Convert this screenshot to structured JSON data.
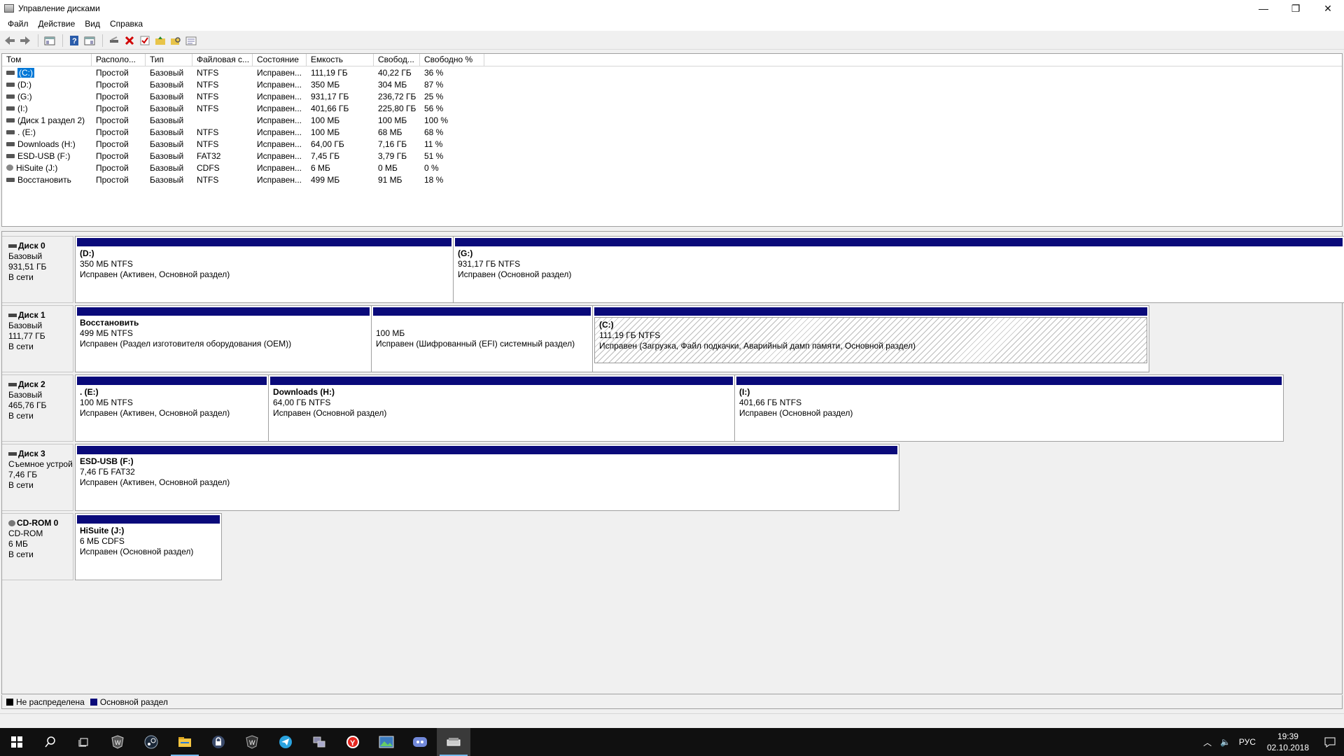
{
  "window": {
    "title": "Управление дисками",
    "minimize": "—",
    "restore": "❐",
    "close": "✕"
  },
  "menu": [
    "Файл",
    "Действие",
    "Вид",
    "Справка"
  ],
  "toolbar_icons": [
    "back-icon",
    "forward-icon",
    "console-tree-icon",
    "help-icon",
    "properties-icon",
    "connect-disk-icon",
    "delete-icon",
    "check-icon",
    "folder-up-icon",
    "search-folder-icon",
    "view-icon"
  ],
  "volume_table": {
    "columns": [
      "Том",
      "Располо...",
      "Тип",
      "Файловая с...",
      "Состояние",
      "Емкость",
      "Свобод...",
      "Свободно %"
    ],
    "rows": [
      {
        "name": "(C:)",
        "layout": "Простой",
        "type": "Базовый",
        "fs": "NTFS",
        "status": "Исправен...",
        "capacity": "111,19 ГБ",
        "free": "40,22 ГБ",
        "pct": "36 %",
        "icon": "drive-icon",
        "selected": true
      },
      {
        "name": "(D:)",
        "layout": "Простой",
        "type": "Базовый",
        "fs": "NTFS",
        "status": "Исправен...",
        "capacity": "350 МБ",
        "free": "304 МБ",
        "pct": "87 %",
        "icon": "drive-icon"
      },
      {
        "name": "(G:)",
        "layout": "Простой",
        "type": "Базовый",
        "fs": "NTFS",
        "status": "Исправен...",
        "capacity": "931,17 ГБ",
        "free": "236,72 ГБ",
        "pct": "25 %",
        "icon": "drive-icon"
      },
      {
        "name": "(I:)",
        "layout": "Простой",
        "type": "Базовый",
        "fs": "NTFS",
        "status": "Исправен...",
        "capacity": "401,66 ГБ",
        "free": "225,80 ГБ",
        "pct": "56 %",
        "icon": "drive-icon"
      },
      {
        "name": "(Диск 1 раздел 2)",
        "layout": "Простой",
        "type": "Базовый",
        "fs": "",
        "status": "Исправен...",
        "capacity": "100 МБ",
        "free": "100 МБ",
        "pct": "100 %",
        "icon": "drive-icon"
      },
      {
        "name": ". (E:)",
        "layout": "Простой",
        "type": "Базовый",
        "fs": "NTFS",
        "status": "Исправен...",
        "capacity": "100 МБ",
        "free": "68 МБ",
        "pct": "68 %",
        "icon": "drive-icon"
      },
      {
        "name": "Downloads (H:)",
        "layout": "Простой",
        "type": "Базовый",
        "fs": "NTFS",
        "status": "Исправен...",
        "capacity": "64,00 ГБ",
        "free": "7,16 ГБ",
        "pct": "11 %",
        "icon": "drive-icon"
      },
      {
        "name": "ESD-USB (F:)",
        "layout": "Простой",
        "type": "Базовый",
        "fs": "FAT32",
        "status": "Исправен...",
        "capacity": "7,45 ГБ",
        "free": "3,79 ГБ",
        "pct": "51 %",
        "icon": "drive-icon"
      },
      {
        "name": "HiSuite (J:)",
        "layout": "Простой",
        "type": "Базовый",
        "fs": "CDFS",
        "status": "Исправен...",
        "capacity": "6 МБ",
        "free": "0 МБ",
        "pct": "0 %",
        "icon": "cd-icon"
      },
      {
        "name": "Восстановить",
        "layout": "Простой",
        "type": "Базовый",
        "fs": "NTFS",
        "status": "Исправен...",
        "capacity": "499 МБ",
        "free": "91 МБ",
        "pct": "18 %",
        "icon": "drive-icon"
      }
    ]
  },
  "disks": [
    {
      "name": "Диск 0",
      "kind": "Базовый",
      "size": "931,51 ГБ",
      "state": "В сети",
      "icon": "disk-icon",
      "partitions": [
        {
          "name": "(D:)",
          "size": "350 МБ NTFS",
          "status": "Исправен (Активен, Основной раздел)"
        },
        {
          "name": "(G:)",
          "size": "931,17 ГБ NTFS",
          "status": "Исправен (Основной раздел)"
        }
      ]
    },
    {
      "name": "Диск 1",
      "kind": "Базовый",
      "size": "111,77 ГБ",
      "state": "В сети",
      "icon": "disk-icon",
      "partitions": [
        {
          "name": "Восстановить",
          "size": "499 МБ NTFS",
          "status": "Исправен (Раздел изготовителя оборудования (OEM))"
        },
        {
          "name": "",
          "size": "100 МБ",
          "status": "Исправен (Шифрованный (EFI) системный раздел)"
        },
        {
          "name": "(C:)",
          "size": "111,19 ГБ NTFS",
          "status": "Исправен (Загрузка, Файл подкачки, Аварийный дамп памяти, Основной раздел)",
          "selected": true
        }
      ]
    },
    {
      "name": "Диск 2",
      "kind": "Базовый",
      "size": "465,76 ГБ",
      "state": "В сети",
      "icon": "disk-icon",
      "partitions": [
        {
          "name": ". (E:)",
          "size": "100 МБ NTFS",
          "status": "Исправен (Активен, Основной раздел)"
        },
        {
          "name": "Downloads (H:)",
          "size": "64,00 ГБ NTFS",
          "status": "Исправен (Основной раздел)"
        },
        {
          "name": "(I:)",
          "size": "401,66 ГБ NTFS",
          "status": "Исправен (Основной раздел)"
        }
      ]
    },
    {
      "name": "Диск 3",
      "kind": "Съемное устрой",
      "size": "7,46 ГБ",
      "state": "В сети",
      "icon": "disk-icon",
      "partitions": [
        {
          "name": "ESD-USB (F:)",
          "size": "7,46 ГБ FAT32",
          "status": "Исправен (Активен, Основной раздел)"
        }
      ]
    },
    {
      "name": "CD-ROM 0",
      "kind": "CD-ROM",
      "size": "6 МБ",
      "state": "В сети",
      "icon": "cd-icon",
      "partitions": [
        {
          "name": "HiSuite (J:)",
          "size": "6 МБ CDFS",
          "status": "Исправен (Основной раздел)"
        }
      ]
    }
  ],
  "legend": [
    {
      "label": "Не распределена",
      "color": "#000000"
    },
    {
      "label": "Основной раздел",
      "color": "#0a0a7a"
    }
  ],
  "taskbar": {
    "apps": [
      "start-icon",
      "search-icon",
      "task-view-icon",
      "world-of-tanks-icon",
      "steam-icon",
      "file-explorer-icon",
      "lock-app-icon",
      "wot-blitz-icon",
      "telegram-icon",
      "network-app-icon",
      "yandex-browser-icon",
      "image-viewer-icon",
      "discord-icon",
      "disk-management-icon"
    ],
    "tray_lang": "РУС",
    "time": "19:39",
    "date": "02.10.2018"
  }
}
